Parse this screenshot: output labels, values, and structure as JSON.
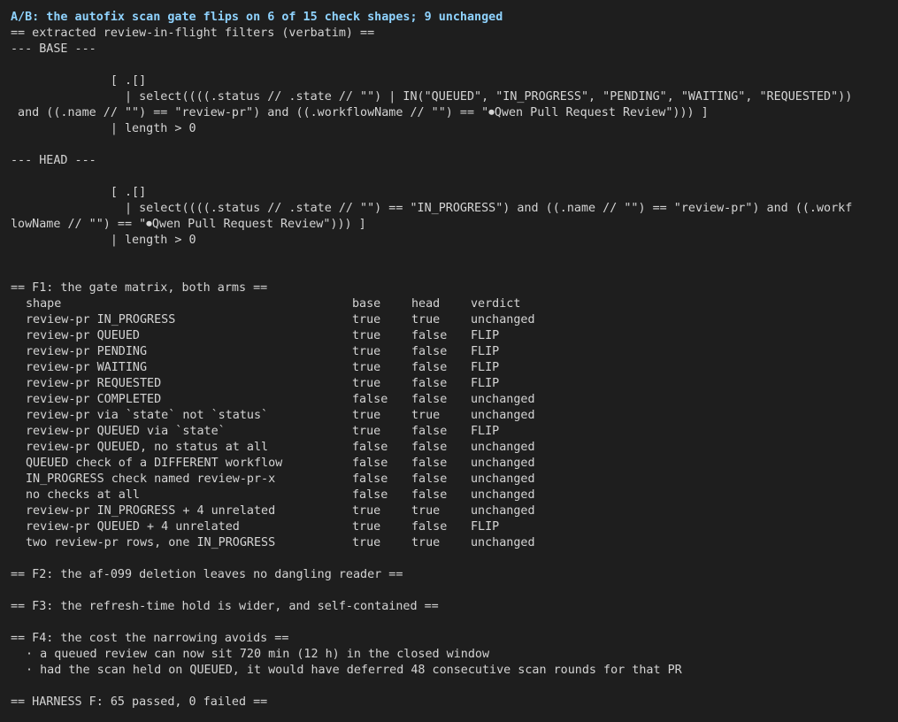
{
  "title": "A/B: the autofix scan gate flips on 6 of 15 check shapes; 9 unchanged",
  "filters": {
    "header": "== extracted review-in-flight filters (verbatim) ==",
    "base": {
      "label": "--- BASE ---",
      "lines": [
        "              [ .[]",
        "                | select((((.status // .state // \"\") | IN(\"QUEUED\", \"IN_PROGRESS\", \"PENDING\", \"WAITING\", \"REQUESTED\"))",
        " and ((.name // \"\") == \"review-pr\") and ((.workflowName // \"\") == \"⏺Qwen Pull Request Review\"))) ]",
        "              | length > 0"
      ]
    },
    "head": {
      "label": "--- HEAD ---",
      "lines": [
        "              [ .[]",
        "                | select((((.status // .state // \"\") == \"IN_PROGRESS\") and ((.name // \"\") == \"review-pr\") and ((.workf",
        "lowName // \"\") == \"⏺Qwen Pull Request Review\"))) ]",
        "              | length > 0"
      ]
    }
  },
  "f1": {
    "header": "== F1: the gate matrix, both arms ==",
    "columns": {
      "shape": "shape",
      "base": "base",
      "head": "head",
      "verdict": "verdict"
    },
    "rows": [
      {
        "shape": "review-pr IN_PROGRESS",
        "base": "true",
        "head": "true",
        "verdict": "unchanged"
      },
      {
        "shape": "review-pr QUEUED",
        "base": "true",
        "head": "false",
        "verdict": "FLIP"
      },
      {
        "shape": "review-pr PENDING",
        "base": "true",
        "head": "false",
        "verdict": "FLIP"
      },
      {
        "shape": "review-pr WAITING",
        "base": "true",
        "head": "false",
        "verdict": "FLIP"
      },
      {
        "shape": "review-pr REQUESTED",
        "base": "true",
        "head": "false",
        "verdict": "FLIP"
      },
      {
        "shape": "review-pr COMPLETED",
        "base": "false",
        "head": "false",
        "verdict": "unchanged"
      },
      {
        "shape": "review-pr via `state` not `status`",
        "base": "true",
        "head": "true",
        "verdict": "unchanged"
      },
      {
        "shape": "review-pr QUEUED via `state`",
        "base": "true",
        "head": "false",
        "verdict": "FLIP"
      },
      {
        "shape": "review-pr QUEUED, no status at all",
        "base": "false",
        "head": "false",
        "verdict": "unchanged"
      },
      {
        "shape": "QUEUED check of a DIFFERENT workflow",
        "base": "false",
        "head": "false",
        "verdict": "unchanged"
      },
      {
        "shape": "IN_PROGRESS check named review-pr-x",
        "base": "false",
        "head": "false",
        "verdict": "unchanged"
      },
      {
        "shape": "no checks at all",
        "base": "false",
        "head": "false",
        "verdict": "unchanged"
      },
      {
        "shape": "review-pr IN_PROGRESS + 4 unrelated",
        "base": "true",
        "head": "true",
        "verdict": "unchanged"
      },
      {
        "shape": "review-pr QUEUED + 4 unrelated",
        "base": "true",
        "head": "false",
        "verdict": "FLIP"
      },
      {
        "shape": "two review-pr rows, one IN_PROGRESS",
        "base": "true",
        "head": "true",
        "verdict": "unchanged"
      }
    ]
  },
  "f2": {
    "header": "== F2: the af-099 deletion leaves no dangling reader =="
  },
  "f3": {
    "header": "== F3: the refresh-time hold is wider, and self-contained =="
  },
  "f4": {
    "header": "== F4: the cost the narrowing avoids ==",
    "bullets": [
      "· a queued review can now sit 720 min (12 h) in the closed window",
      "· had the scan held on QUEUED, it would have deferred 48 consecutive scan rounds for that PR"
    ]
  },
  "harness": {
    "summary": "== HARNESS F: 65 passed, 0 failed =="
  }
}
